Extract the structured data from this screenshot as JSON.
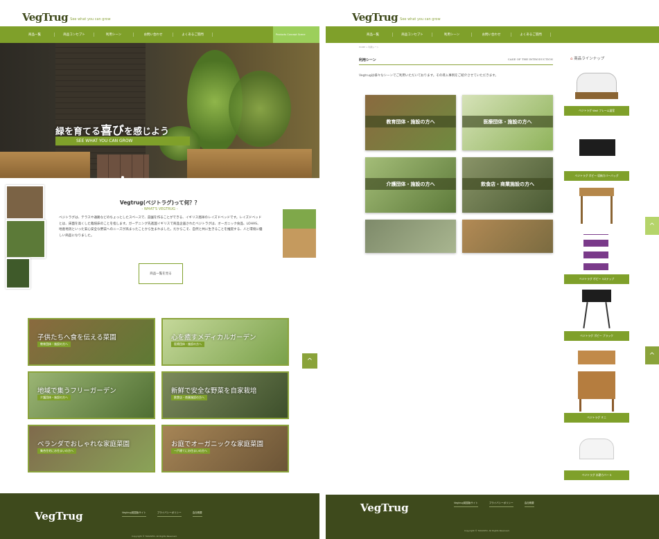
{
  "brand": {
    "logo": "VegTrug",
    "tagline": "See what you can grow"
  },
  "nav": [
    "商品一覧",
    "商品コンセプト",
    "利用シーン",
    "お問い合わせ",
    "よくあるご質問"
  ],
  "left": {
    "hero": {
      "title_pre": "緑を育てる",
      "title_em": "喜び",
      "title_post": "を感じよう",
      "subtitle": "SEE WHAT YOU CAN GROW"
    },
    "intro": {
      "title": "Vegtrug(ベジトラグ)って何？？",
      "subtitle": "- WHAT'S VEGTRUG -",
      "text": "ベジトラグは、テラスや通路などのちょっとしたスペースで、菜園を作ることができる、イギリス発祥のレイズドベッドです。レイズドベッドとは、床面を高くした栽培床のことを指します。ガーデニング先進国イギリスで商品企画されたベジトラグは、オーガニック食品、LOHAS、地産地消といった安心安全な野菜へのニーズが高まったことから生まれました。だからこそ、自然と共に生きることを推奨する、人と環境に優しい商品になりました。",
      "button": "商品一覧を見る"
    },
    "cards": [
      {
        "title": "子供たちへ食を伝える菜園",
        "badge": "教育団体・施設の方へ"
      },
      {
        "title": "心を癒すメディカルガーデン",
        "badge": "医療団体・施設の方へ"
      },
      {
        "title": "地域で集うフリーガーデン",
        "badge": "介護団体・施設の方へ"
      },
      {
        "title": "新鮮で安全な野菜を自家栽培",
        "badge": "飲食店・商業施設の方へ"
      },
      {
        "title": "ベランダでおしゃれな家庭菜園",
        "badge": "集合住宅にお住まいの方へ"
      },
      {
        "title": "お庭でオーガニックな家庭菜園",
        "badge": "一戸建てにお住まいの方へ"
      }
    ],
    "ghost_nav": "Products Concept Scene",
    "up_icon": "^"
  },
  "footer": {
    "logo": "VegTrug",
    "links": [
      "Vegtrug英国版サイト",
      "プライバシーポリシー",
      "会社概要"
    ],
    "copyright": "Copyright © TAKASHO. All Rights Reserved."
  },
  "right": {
    "breadcrumb": "HOME > 利用シーン",
    "section_title": "利用シーン",
    "section_en": "CASE OF THE INTRODUCTION",
    "section_desc": "Vegtrugは様々なシーンでご利用いただいております。その導入事例をご紹介させていただきます。",
    "scenes": [
      "教育団体・施設の方へ",
      "医療団体・施設の方へ",
      "介護団体・施設の方へ",
      "飲食店・商業施設の方へ",
      "",
      ""
    ],
    "lineup_title": "商品ラインナップ",
    "products": [
      "ベジトラグ Wall フレーム温室",
      "ベジトラグ ポピー 収納カバーバッグ",
      "",
      "ベジトラグ ポピー 3ステップ",
      "ベジトラグ ポピー ブラック",
      "ベジトラグ ミニ",
      "ベジトラグ 水耕カバー S"
    ],
    "up_icon": "^"
  }
}
